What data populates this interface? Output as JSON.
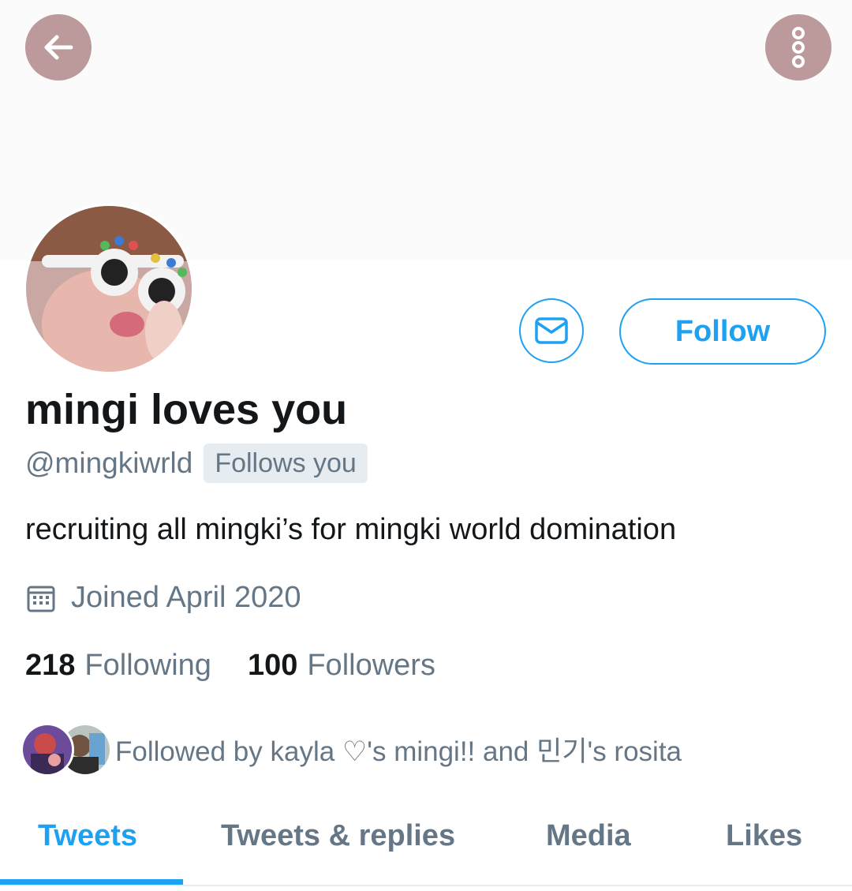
{
  "profile": {
    "display_name": "mingi loves you",
    "handle": "@mingkiwrld",
    "follows_you_badge": "Follows you",
    "bio": "recruiting all mingki’s for mingki world domination",
    "joined": "Joined April 2020"
  },
  "actions": {
    "follow_label": "Follow"
  },
  "stats": {
    "following_count": "218",
    "following_label": "Following",
    "followers_count": "100",
    "followers_label": "Followers"
  },
  "followed_by": {
    "text": "Followed by kayla ♡'s mingi!! and 민기's rosita"
  },
  "tabs": [
    {
      "label": "Tweets",
      "active": true
    },
    {
      "label": "Tweets & replies",
      "active": false
    },
    {
      "label": "Media",
      "active": false
    },
    {
      "label": "Likes",
      "active": false
    }
  ],
  "colors": {
    "accent": "#1da1f2",
    "header_button_bg": "#bc999a",
    "secondary_text": "#657786",
    "badge_bg": "#e6ecf0"
  },
  "icons": {
    "back": "arrow-left-icon",
    "more": "more-vertical-icon",
    "message": "envelope-icon",
    "calendar": "calendar-icon"
  }
}
